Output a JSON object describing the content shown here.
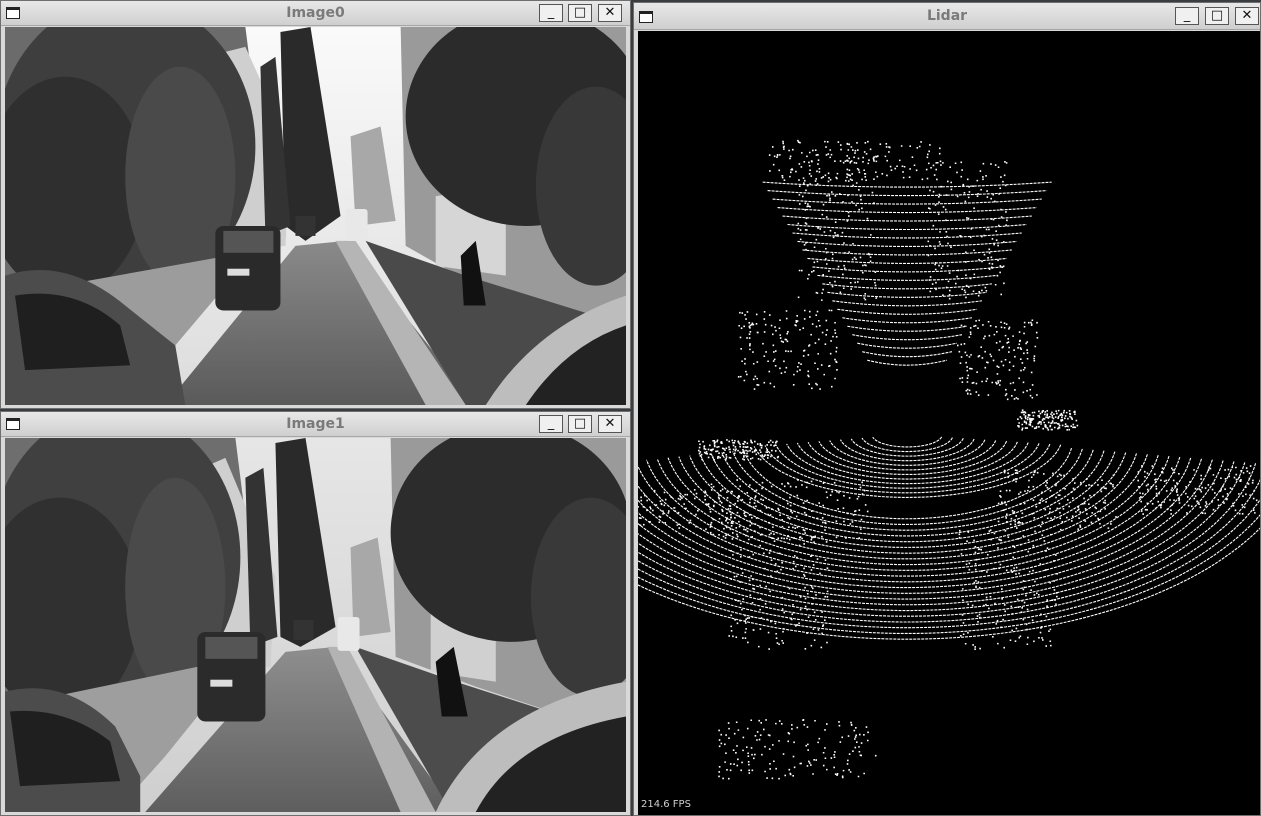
{
  "windows": {
    "image0": {
      "title": "Image0"
    },
    "image1": {
      "title": "Image1"
    },
    "lidar": {
      "title": "Lidar",
      "fps": "214.6 FPS"
    }
  },
  "controls": {
    "minimize": "_",
    "maximize": "□",
    "close": "✕"
  },
  "icons": {
    "window_menu": "window-menu-icon"
  },
  "colors": {
    "lidar_background": "#000000",
    "lidar_points": "#ffffff"
  }
}
